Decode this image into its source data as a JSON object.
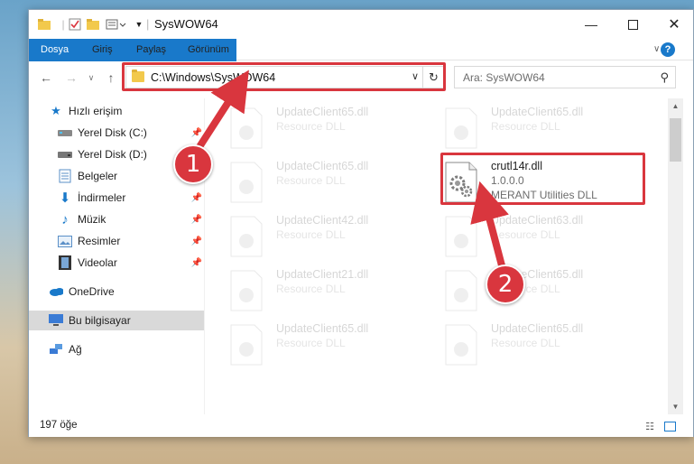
{
  "window": {
    "title": "SysWOW64",
    "minimize_icon": "minimize-icon",
    "maximize_icon": "maximize-icon",
    "close_icon": "close-icon"
  },
  "ribbon": {
    "tabs": [
      {
        "label": "Dosya"
      },
      {
        "label": "Giriş"
      },
      {
        "label": "Paylaş"
      },
      {
        "label": "Görünüm"
      }
    ],
    "accent": "#1979ca"
  },
  "address": {
    "path": "C:\\Windows\\SysWOW64",
    "highlight_color": "#d9363e"
  },
  "search": {
    "placeholder": "Ara: SysWOW64"
  },
  "sidebar": {
    "items": [
      {
        "label": "Hızlı erişim",
        "icon": "star-icon"
      },
      {
        "label": "Yerel Disk (C:)",
        "icon": "drive-icon",
        "pinned": true
      },
      {
        "label": "Yerel Disk (D:)",
        "icon": "drive-icon"
      },
      {
        "label": "Belgeler",
        "icon": "documents-icon",
        "pinned": true
      },
      {
        "label": "İndirmeler",
        "icon": "download-icon",
        "pinned": true
      },
      {
        "label": "Müzik",
        "icon": "music-icon",
        "pinned": true
      },
      {
        "label": "Resimler",
        "icon": "pictures-icon",
        "pinned": true
      },
      {
        "label": "Videolar",
        "icon": "videos-icon",
        "pinned": true
      },
      {
        "label": "OneDrive",
        "icon": "cloud-icon"
      },
      {
        "label": "Bu bilgisayar",
        "icon": "computer-icon",
        "selected": true
      },
      {
        "label": "Ağ",
        "icon": "network-icon"
      }
    ]
  },
  "files": [
    {
      "name": "UpdateClient65.dll",
      "type": "Resource DLL"
    },
    {
      "name": "UpdateClient65.dll",
      "type": "Resource DLL"
    },
    {
      "name": "UpdateClient65.dll",
      "type": "Resource DLL"
    },
    {
      "name": "crutl14r.dll",
      "version": "1.0.0.0",
      "type": "MERANT Utilities DLL",
      "highlighted": true
    },
    {
      "name": "UpdateClient42.dll",
      "type": "Resource DLL"
    },
    {
      "name": "UpdateClient63.dll",
      "type": "Resource DLL"
    },
    {
      "name": "UpdateClient21.dll",
      "type": "Resource DLL"
    },
    {
      "name": "UpdateClient65.dll",
      "type": "Resource DLL"
    },
    {
      "name": "UpdateClient65.dll",
      "type": "Resource DLL"
    },
    {
      "name": "UpdateClient65.dll",
      "type": "Resource DLL"
    }
  ],
  "status": {
    "item_count": "197 öğe"
  },
  "markers": [
    {
      "label": "1"
    },
    {
      "label": "2"
    }
  ]
}
